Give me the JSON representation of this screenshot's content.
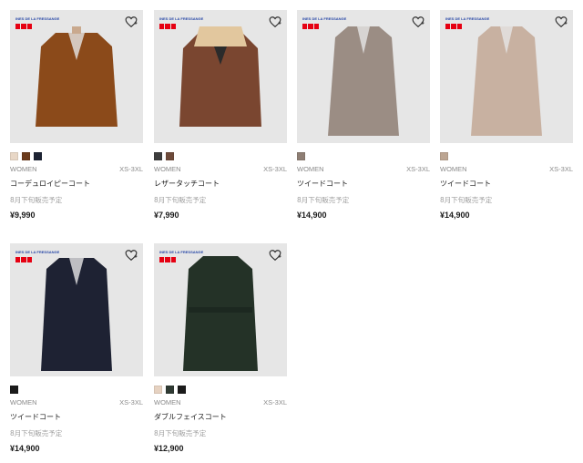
{
  "products": [
    {
      "brand": "INES DE LA FRESSANGE",
      "gender": "WOMEN",
      "size": "XS-3XL",
      "name": "コーデュロイピーコート",
      "note": "8月下旬販売予定",
      "price": "¥9,990",
      "coat_color": "#8b4a1a",
      "swatches": [
        "#e8d7c6",
        "#6b3b1c",
        "#1d2333"
      ]
    },
    {
      "brand": "INES DE LA FRESSANGE",
      "gender": "WOMEN",
      "size": "XS-3XL",
      "name": "レザータッチコート",
      "note": "8月下旬販売予定",
      "price": "¥7,990",
      "coat_color": "#7a4630",
      "swatches": [
        "#3d3d3d",
        "#6e4a3a"
      ]
    },
    {
      "brand": "INES DE LA FRESSANGE",
      "gender": "WOMEN",
      "size": "XS-3XL",
      "name": "ツイードコート",
      "note": "8月下旬販売予定",
      "price": "¥14,900",
      "coat_color": "#9b8d84",
      "swatches": [
        "#8e7e74"
      ]
    },
    {
      "brand": "INES DE LA FRESSANGE",
      "gender": "WOMEN",
      "size": "XS-3XL",
      "name": "ツイードコート",
      "note": "8月下旬販売予定",
      "price": "¥14,900",
      "coat_color": "#c8b1a1",
      "swatches": [
        "#bca592"
      ]
    },
    {
      "brand": "INES DE LA FRESSANGE",
      "gender": "WOMEN",
      "size": "XS-3XL",
      "name": "ツイードコート",
      "note": "8月下旬販売予定",
      "price": "¥14,900",
      "coat_color": "#1e2233",
      "swatches": [
        "#1b1b1b"
      ]
    },
    {
      "brand": "INES DE LA FRESSANGE",
      "gender": "WOMEN",
      "size": "XS-3XL",
      "name": "ダブルフェイスコート",
      "note": "8月下旬販売予定",
      "price": "¥12,900",
      "coat_color": "#243227",
      "swatches": [
        "#e6d2c1",
        "#2f3a33",
        "#1b1b1b"
      ]
    }
  ]
}
